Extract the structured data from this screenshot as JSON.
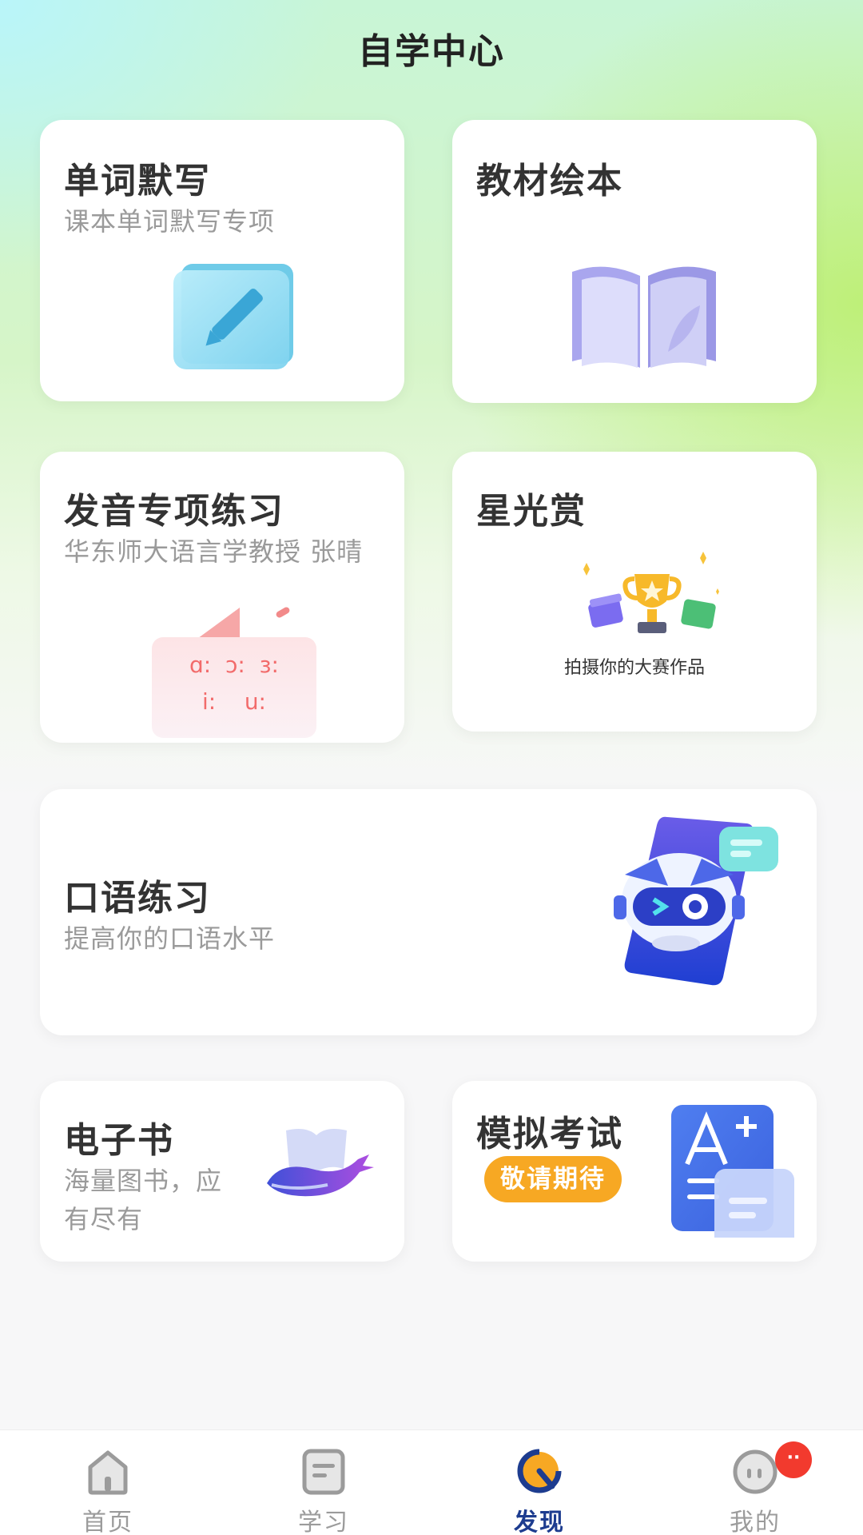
{
  "header": {
    "title": "自学中心"
  },
  "cards": {
    "dictation": {
      "title": "单词默写",
      "subtitle": "课本单词默写专项"
    },
    "picture_book": {
      "title": "教材绘本"
    },
    "pronunciation": {
      "title": "发音专项练习",
      "subtitle": "华东师大语言学教授 张晴",
      "phonetics_row1": "ɑ:  ɔ:  ɜ:",
      "phonetics_row2": "i:    u:"
    },
    "starlight": {
      "title": "星光赏",
      "caption": "拍摄你的大赛作品"
    },
    "speaking": {
      "title": "口语练习",
      "subtitle": "提高你的口语水平"
    },
    "ebook": {
      "title": "电子书",
      "subtitle_line1": "海量图书，应",
      "subtitle_line2": "有尽有"
    },
    "mock_exam": {
      "title": "模拟考试",
      "badge": "敬请期待"
    }
  },
  "tabbar": {
    "items": [
      {
        "label": "首页",
        "icon": "home-icon",
        "active": false
      },
      {
        "label": "学习",
        "icon": "study-icon",
        "active": false
      },
      {
        "label": "发现",
        "icon": "discover-icon",
        "active": true
      },
      {
        "label": "我的",
        "icon": "profile-icon",
        "active": false
      }
    ],
    "profile_badge": "··"
  },
  "colors": {
    "accent": "#1d3c8f",
    "badge_orange": "#f7a823",
    "notification_red": "#f23a2e"
  }
}
